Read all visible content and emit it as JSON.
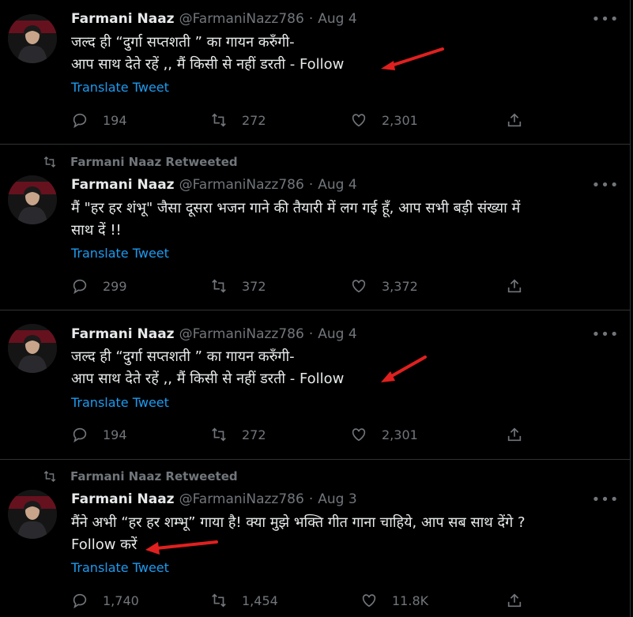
{
  "tweets": [
    {
      "retweeted_by": "",
      "author": "Farmani Naaz",
      "handle": "@FarmaniNazz786",
      "separator": "·",
      "date": "Aug 4",
      "lines": [
        "जल्द ही “दुर्गा सप्तशती ” का गायन करुँगी-",
        "आप साथ देते रहें ,, मैं किसी से नहीं डरती - Follow"
      ],
      "translate": "Translate Tweet",
      "replies": "194",
      "retweets": "272",
      "likes": "2,301"
    },
    {
      "retweeted_by": "Farmani Naaz Retweeted",
      "author": "Farmani Naaz",
      "handle": "@FarmaniNazz786",
      "separator": "·",
      "date": "Aug 4",
      "lines": [
        "मैं \"हर हर शंभू\" जैसा दूसरा भजन गाने की तैयारी में लग गई हूँ, आप सभी बड़ी संख्या में",
        "साथ दें !!"
      ],
      "translate": "Translate Tweet",
      "replies": "299",
      "retweets": "372",
      "likes": "3,372"
    },
    {
      "retweeted_by": "",
      "author": "Farmani Naaz",
      "handle": "@FarmaniNazz786",
      "separator": "·",
      "date": "Aug 4",
      "lines": [
        "जल्द ही “दुर्गा सप्तशती ” का गायन करुँगी-",
        "आप साथ देते रहें ,, मैं किसी से नहीं डरती - Follow"
      ],
      "translate": "Translate Tweet",
      "replies": "194",
      "retweets": "272",
      "likes": "2,301"
    },
    {
      "retweeted_by": "Farmani Naaz Retweeted",
      "author": "Farmani Naaz",
      "handle": "@FarmaniNazz786",
      "separator": "·",
      "date": "Aug 3",
      "lines": [
        "मैंने अभी “हर हर शम्भू” गाया है! क्या मुझे भक्ति गीत गाना चाहिये, आप सब साथ देंगे ?",
        "Follow करें"
      ],
      "translate": "Translate Tweet",
      "replies": "1,740",
      "retweets": "1,454",
      "likes": "11.8K"
    }
  ],
  "colors": {
    "background": "#000000",
    "text": "#e7e9ea",
    "muted": "#71767b",
    "link": "#1d9bf0",
    "annotation_arrow": "#e0201f"
  },
  "icons": [
    "retweet-icon",
    "reply-icon",
    "like-icon",
    "share-icon",
    "more-icon"
  ]
}
